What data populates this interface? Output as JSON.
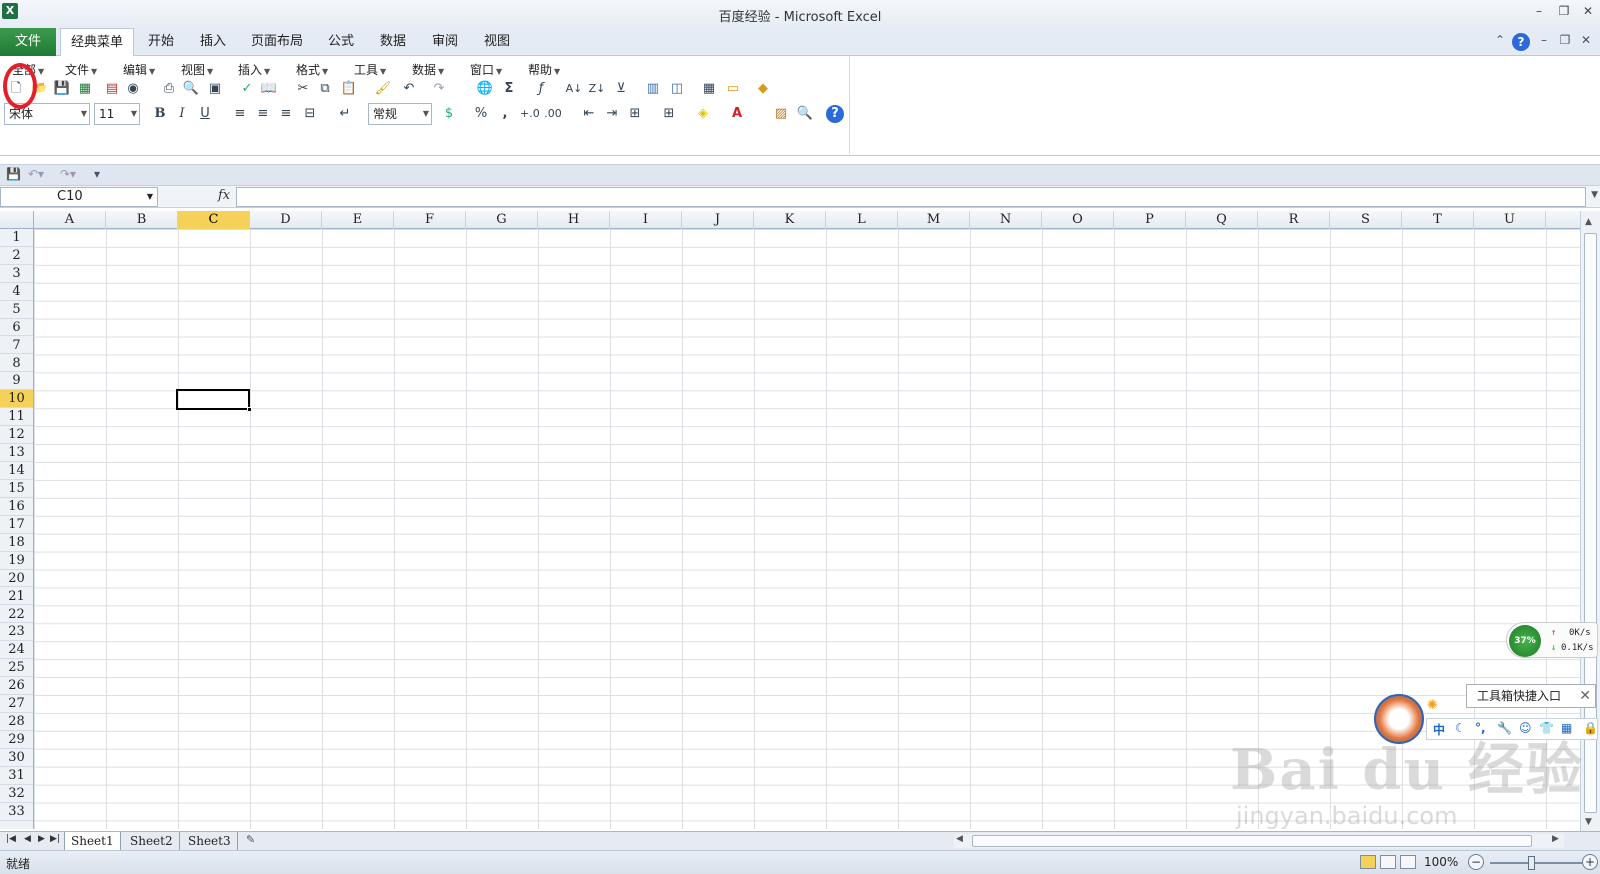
{
  "window": {
    "title": "百度经验 - Microsoft Excel",
    "controls": [
      "–",
      "❐",
      "✕"
    ]
  },
  "ribbon_tabs": {
    "file": "文件",
    "tabs": [
      "经典菜单",
      "开始",
      "插入",
      "页面布局",
      "公式",
      "数据",
      "审阅",
      "视图"
    ],
    "active": "经典菜单"
  },
  "classic_menu": {
    "items": [
      "全部",
      "文件",
      "编辑",
      "视图",
      "插入",
      "格式",
      "工具",
      "数据",
      "窗口",
      "帮助"
    ]
  },
  "formatting": {
    "font_name": "宋体",
    "font_size": "11",
    "number_format": "常规",
    "bold": "B",
    "italic": "I",
    "underline": "U",
    "percent": "%",
    "comma": ","
  },
  "name_box": {
    "value": "C10"
  },
  "formula_bar": {
    "fx": "fx",
    "value": ""
  },
  "grid": {
    "columns": [
      "A",
      "B",
      "C",
      "D",
      "E",
      "F",
      "G",
      "H",
      "I",
      "J",
      "K",
      "L",
      "M",
      "N",
      "O",
      "P",
      "Q",
      "R",
      "S",
      "T",
      "U"
    ],
    "rows": [
      "1",
      "2",
      "3",
      "4",
      "5",
      "6",
      "7",
      "8",
      "9",
      "10",
      "11",
      "12",
      "13",
      "14",
      "15",
      "16",
      "17",
      "18",
      "19",
      "20",
      "21",
      "22",
      "23",
      "24",
      "25",
      "26",
      "27",
      "28",
      "29",
      "30",
      "31",
      "32",
      "33"
    ],
    "selected_column": "C",
    "selected_row": "10"
  },
  "sheets": {
    "tabs": [
      "Sheet1",
      "Sheet2",
      "Sheet3"
    ],
    "active": "Sheet1"
  },
  "status": {
    "text": "就绪",
    "zoom": "100%"
  },
  "net_widget": {
    "percent": "37%",
    "up": "0K/s",
    "down": "0.1K/s"
  },
  "toolbox": {
    "label": "工具箱快捷入口",
    "ime": "中"
  },
  "watermark": {
    "brand": "Bai du 经验",
    "url": "jingyan.baidu.com"
  },
  "colors": {
    "file_tab": "#1f7a33",
    "selection": "#f6d15a",
    "highlight_ring": "#e3202a"
  }
}
